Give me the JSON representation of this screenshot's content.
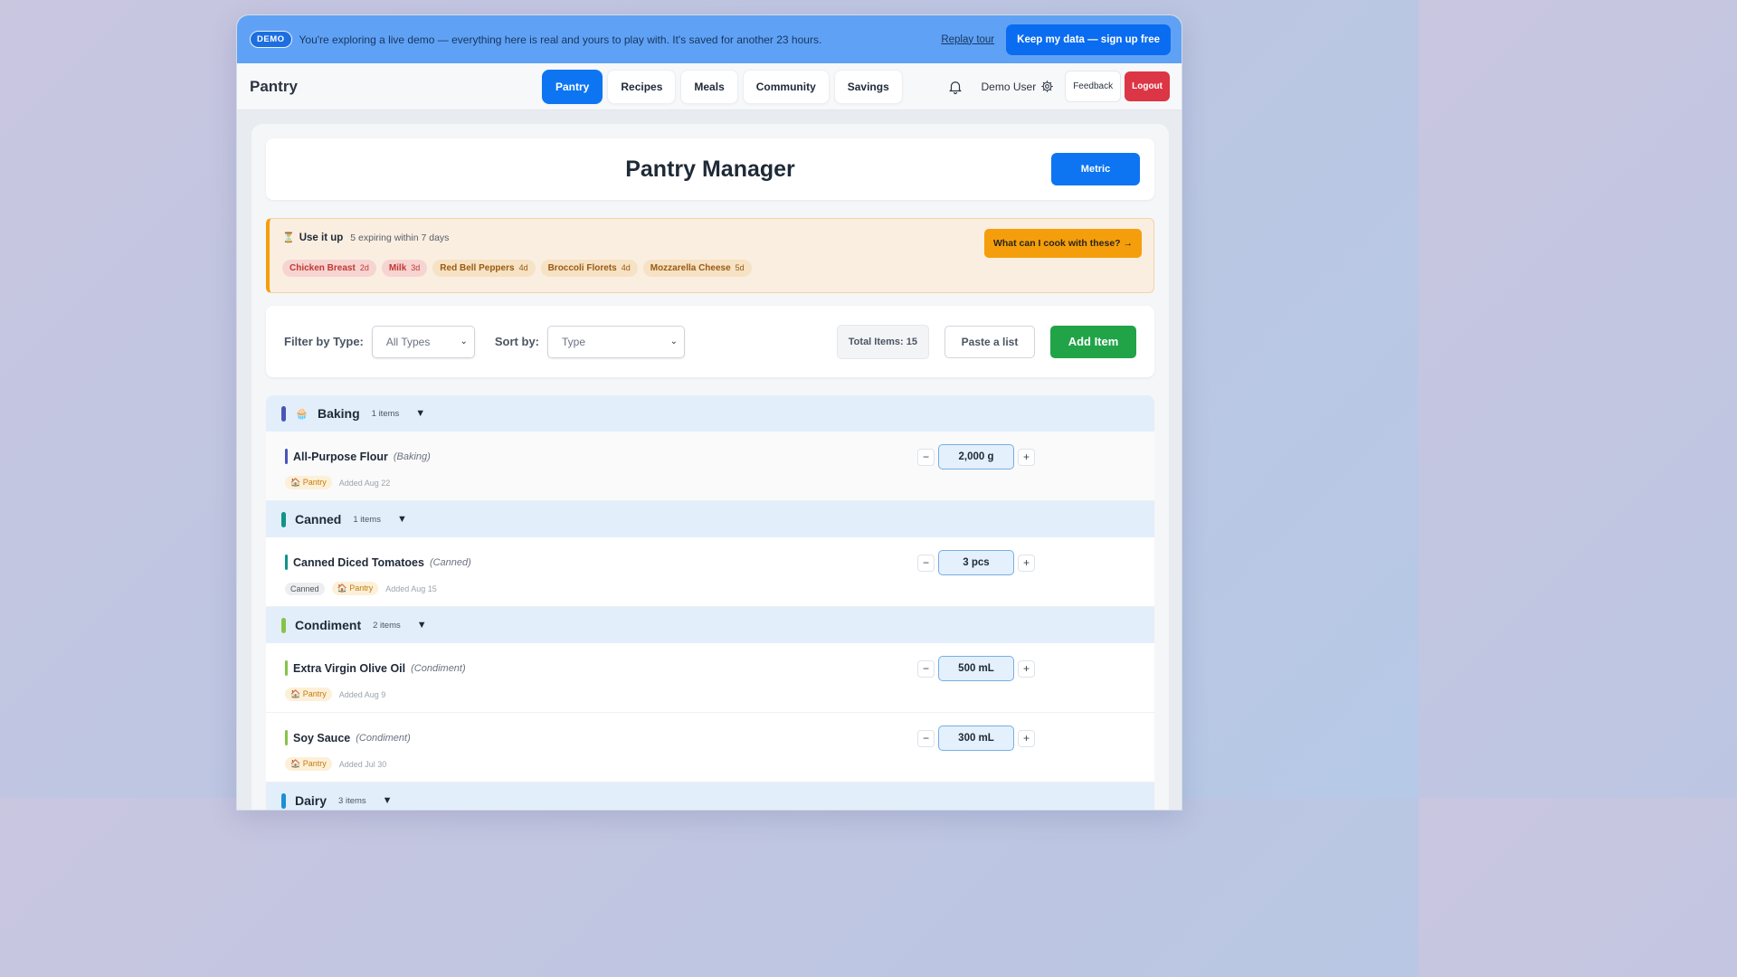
{
  "demo": {
    "badge": "DEMO",
    "message": "You're exploring a live demo — everything here is real and yours to play with. It's saved for another 23 hours.",
    "replay_label": "Replay tour",
    "signup_label": "Keep my data — sign up free"
  },
  "nav": {
    "brand": "Pantry",
    "tabs": [
      {
        "label": "Pantry",
        "active": true
      },
      {
        "label": "Recipes"
      },
      {
        "label": "Meals"
      },
      {
        "label": "Community"
      },
      {
        "label": "Savings"
      }
    ],
    "user": "Demo User",
    "feedback": "Feedback",
    "logout": "Logout"
  },
  "header": {
    "title": "Pantry Manager",
    "units_button": "Metric"
  },
  "use_it_up": {
    "icon": "⏳",
    "title": "Use it up",
    "subtitle": "5 expiring within 7 days",
    "cook_button": "What can I cook with these? →",
    "chips": [
      {
        "name": "Chicken Breast",
        "days": "2d",
        "style": "red"
      },
      {
        "name": "Milk",
        "days": "3d",
        "style": "red"
      },
      {
        "name": "Red Bell Peppers",
        "days": "4d",
        "style": "tan"
      },
      {
        "name": "Broccoli Florets",
        "days": "4d",
        "style": "tan"
      },
      {
        "name": "Mozzarella Cheese",
        "days": "5d",
        "style": "tan"
      }
    ]
  },
  "filters": {
    "filter_label": "Filter by Type:",
    "filter_value": "All Types",
    "sort_label": "Sort by:",
    "sort_value": "Type",
    "total": "Total Items: 15",
    "paste_label": "Paste a list",
    "add_label": "Add Item"
  },
  "groups": [
    {
      "name": "Baking",
      "icon": "🧁",
      "count": "1 items",
      "color": "#4a55b8",
      "items": [
        {
          "name": "All-Purpose Flour",
          "type": "(Baking)",
          "category_tag": "",
          "location": "🏠 Pantry",
          "added": "Added Aug 22",
          "qty": "2,000 g"
        }
      ]
    },
    {
      "name": "Canned",
      "icon": "",
      "count": "1 items",
      "color": "#0f9488",
      "items": [
        {
          "name": "Canned Diced Tomatoes",
          "type": "(Canned)",
          "category_tag": "Canned",
          "location": "🏠 Pantry",
          "added": "Added Aug 15",
          "qty": "3 pcs"
        }
      ]
    },
    {
      "name": "Condiment",
      "icon": "",
      "count": "2 items",
      "color": "#86c34a",
      "items": [
        {
          "name": "Extra Virgin Olive Oil",
          "type": "(Condiment)",
          "category_tag": "",
          "location": "🏠 Pantry",
          "added": "Added Aug 9",
          "qty": "500 mL"
        },
        {
          "name": "Soy Sauce",
          "type": "(Condiment)",
          "category_tag": "",
          "location": "🏠 Pantry",
          "added": "Added Jul 30",
          "qty": "300 mL"
        }
      ]
    },
    {
      "name": "Dairy",
      "icon": "",
      "count": "3 items",
      "color": "#1d8fd6",
      "items": []
    }
  ]
}
